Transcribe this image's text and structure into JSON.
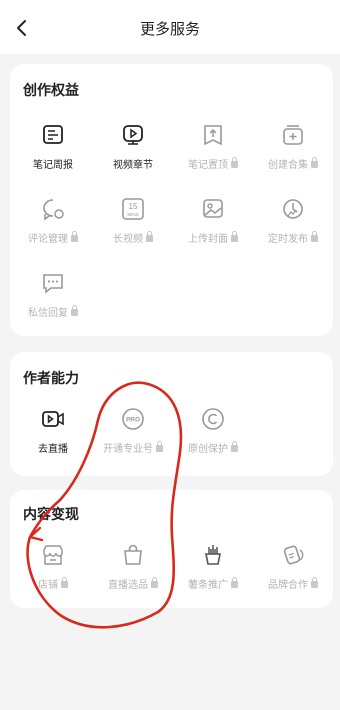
{
  "header": {
    "title": "更多服务"
  },
  "sections": [
    {
      "title": "创作权益",
      "items": [
        {
          "label": "笔记周报",
          "icon": "note-report-icon",
          "locked": false
        },
        {
          "label": "视频章节",
          "icon": "video-chapter-icon",
          "locked": false
        },
        {
          "label": "笔记置顶",
          "icon": "pin-note-icon",
          "locked": true
        },
        {
          "label": "创建合集",
          "icon": "collection-icon",
          "locked": true
        },
        {
          "label": "评论管理",
          "icon": "comment-manage-icon",
          "locked": true
        },
        {
          "label": "长视频",
          "icon": "long-video-icon",
          "locked": true
        },
        {
          "label": "上传封面",
          "icon": "upload-cover-icon",
          "locked": true
        },
        {
          "label": "定时发布",
          "icon": "schedule-publish-icon",
          "locked": true
        },
        {
          "label": "私信回复",
          "icon": "dm-reply-icon",
          "locked": true
        }
      ]
    },
    {
      "title": "作者能力",
      "items": [
        {
          "label": "去直播",
          "icon": "live-stream-icon",
          "locked": false
        },
        {
          "label": "开通专业号",
          "icon": "pro-account-icon",
          "locked": true
        },
        {
          "label": "原创保护",
          "icon": "copyright-icon",
          "locked": true
        }
      ]
    },
    {
      "title": "内容变现",
      "items": [
        {
          "label": "店铺",
          "icon": "shop-icon",
          "locked": true
        },
        {
          "label": "直播选品",
          "icon": "shopping-bag-icon",
          "locked": true
        },
        {
          "label": "薯条推广",
          "icon": "fries-promo-icon",
          "locked": true
        },
        {
          "label": "品牌合作",
          "icon": "brand-coop-icon",
          "locked": true
        }
      ]
    }
  ],
  "icon_text": {
    "long_video_badge_top": "15",
    "long_video_badge_bottom": "MINS",
    "pro_badge": "PRO"
  },
  "colors": {
    "active_text": "#222222",
    "disabled_text": "#b3b3b3",
    "annotation": "#d7291c"
  }
}
